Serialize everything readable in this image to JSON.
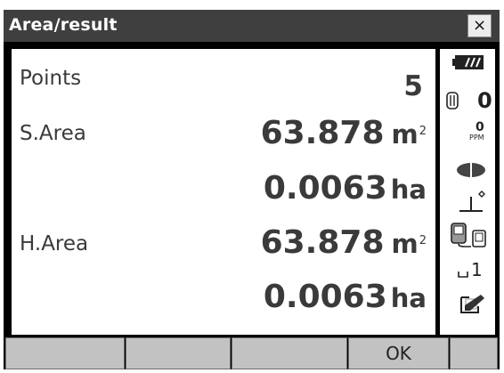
{
  "window": {
    "title": "Area/result",
    "close_label": "×"
  },
  "results": {
    "points": {
      "label": "Points",
      "value": "5"
    },
    "s_area": {
      "label": "S.Area",
      "m2": "63.878",
      "m2_unit": "m",
      "m2_sup": "2",
      "ha": "0.0063",
      "ha_unit": "ha"
    },
    "h_area": {
      "label": "H.Area",
      "m2": "63.878",
      "m2_unit": "m",
      "m2_sup": "2",
      "ha": "0.0063",
      "ha_unit": "ha"
    }
  },
  "status": {
    "icons": [
      "battery-icon",
      "prism-icon",
      "ppm-icon",
      "laser-icon",
      "tilt-icon",
      "communication-icon",
      "input-mode-icon",
      "edit-icon"
    ],
    "prism_constant": "0",
    "ppm_value": "0",
    "ppm_unit": "PPM",
    "input_mode": "1"
  },
  "softkeys": [
    "",
    "",
    "",
    "OK",
    ""
  ]
}
